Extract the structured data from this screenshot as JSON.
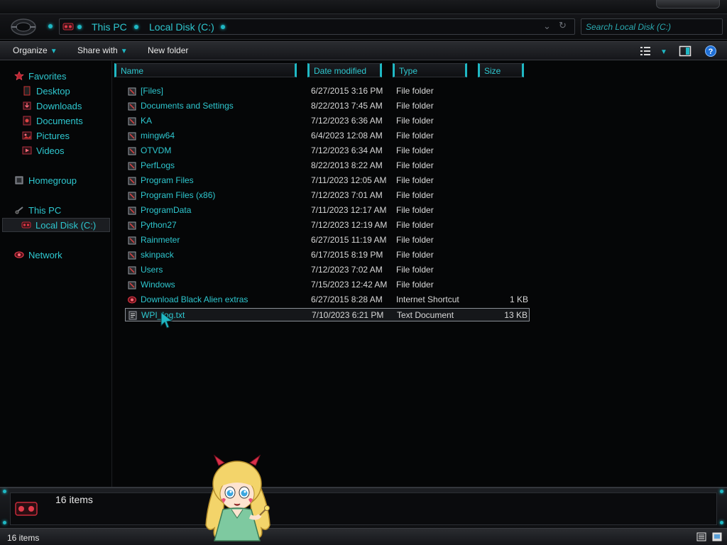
{
  "address": {
    "crumbs": [
      "This PC",
      "Local Disk (C:)"
    ],
    "search_placeholder": "Search Local Disk (C:)"
  },
  "toolbar": {
    "organize": "Organize",
    "share_with": "Share with",
    "new_folder": "New folder"
  },
  "nav": {
    "favorites": "Favorites",
    "desktop": "Desktop",
    "downloads": "Downloads",
    "documents": "Documents",
    "pictures": "Pictures",
    "videos": "Videos",
    "homegroup": "Homegroup",
    "this_pc": "This PC",
    "local_disk": "Local Disk (C:)",
    "network": "Network"
  },
  "columns": {
    "name": "Name",
    "date": "Date modified",
    "type": "Type",
    "size": "Size"
  },
  "files": [
    {
      "name": "[Files]",
      "date": "6/27/2015 3:16 PM",
      "type": "File folder",
      "size": ""
    },
    {
      "name": "Documents and Settings",
      "date": "8/22/2013 7:45 AM",
      "type": "File folder",
      "size": ""
    },
    {
      "name": "KA",
      "date": "7/12/2023 6:36 AM",
      "type": "File folder",
      "size": ""
    },
    {
      "name": "mingw64",
      "date": "6/4/2023 12:08 AM",
      "type": "File folder",
      "size": ""
    },
    {
      "name": "OTVDM",
      "date": "7/12/2023 6:34 AM",
      "type": "File folder",
      "size": ""
    },
    {
      "name": "PerfLogs",
      "date": "8/22/2013 8:22 AM",
      "type": "File folder",
      "size": ""
    },
    {
      "name": "Program Files",
      "date": "7/11/2023 12:05 AM",
      "type": "File folder",
      "size": ""
    },
    {
      "name": "Program Files (x86)",
      "date": "7/12/2023 7:01 AM",
      "type": "File folder",
      "size": ""
    },
    {
      "name": "ProgramData",
      "date": "7/11/2023 12:17 AM",
      "type": "File folder",
      "size": ""
    },
    {
      "name": "Python27",
      "date": "7/12/2023 12:19 AM",
      "type": "File folder",
      "size": ""
    },
    {
      "name": "Rainmeter",
      "date": "6/27/2015 11:19 AM",
      "type": "File folder",
      "size": ""
    },
    {
      "name": "skinpack",
      "date": "6/17/2015 8:19 PM",
      "type": "File folder",
      "size": ""
    },
    {
      "name": "Users",
      "date": "7/12/2023 7:02 AM",
      "type": "File folder",
      "size": ""
    },
    {
      "name": "Windows",
      "date": "7/15/2023 12:42 AM",
      "type": "File folder",
      "size": ""
    },
    {
      "name": "Download Black Alien extras",
      "date": "6/27/2015 8:28 AM",
      "type": "Internet Shortcut",
      "size": "1 KB"
    },
    {
      "name": "WPI_log.txt",
      "date": "7/10/2023 6:21 PM",
      "type": "Text Document",
      "size": "13 KB"
    }
  ],
  "details": {
    "count": "16 items"
  },
  "status": {
    "text": "16 items"
  },
  "colors": {
    "accent": "#1fb8c4",
    "text": "#2ec8d0",
    "background": "#060708"
  }
}
